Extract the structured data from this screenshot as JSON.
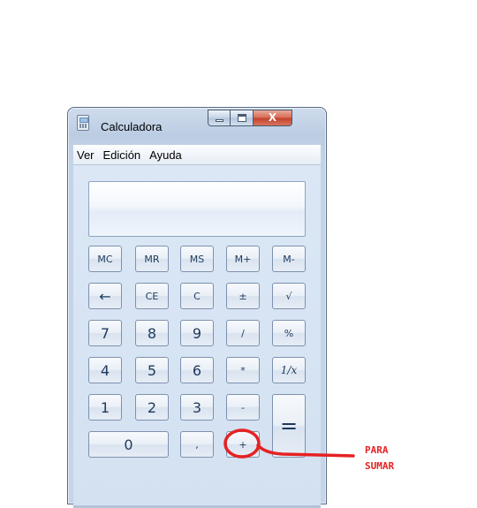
{
  "window": {
    "title": "Calculadora",
    "close_glyph": "X",
    "icon": "calculator-icon"
  },
  "menu": [
    "Ver",
    "Edición",
    "Ayuda"
  ],
  "display": {
    "value": ""
  },
  "keys": {
    "mc": "MC",
    "mr": "MR",
    "ms": "MS",
    "mplus": "M+",
    "mminus": "M-",
    "back": "←",
    "ce": "CE",
    "c": "C",
    "plusminus": "±",
    "sqrt": "√",
    "n7": "7",
    "n8": "8",
    "n9": "9",
    "div": "/",
    "pct": "%",
    "n4": "4",
    "n5": "5",
    "n6": "6",
    "mul": "*",
    "recip": "1/x",
    "n1": "1",
    "n2": "2",
    "n3": "3",
    "sub": "-",
    "eq": "=",
    "n0": "0",
    "dec": ",",
    "add": "+"
  },
  "annotation": {
    "line1": "PARA",
    "line2": "SUMAR",
    "color": "#e52222"
  }
}
